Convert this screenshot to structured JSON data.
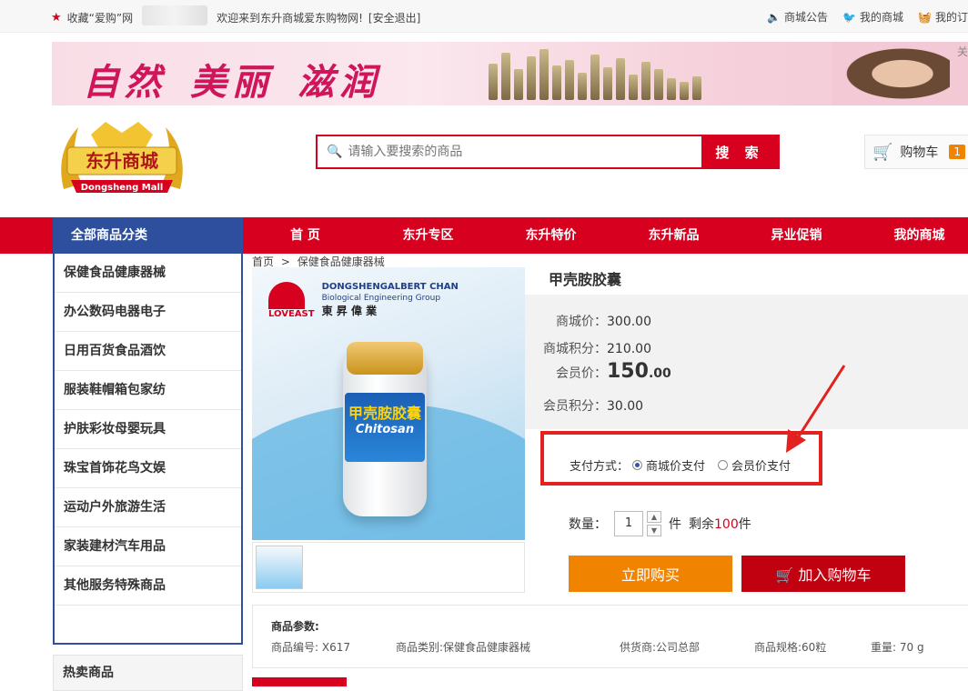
{
  "topbar": {
    "favorite": "收藏“爱购”网",
    "welcome": "欢迎来到东升商城爱东购物网!",
    "logout": "[安全退出]",
    "announce": "商城公告",
    "my_mall": "我的商城",
    "my_orders": "我的订"
  },
  "banner": {
    "slogan_1": "自然",
    "slogan_2": "美丽",
    "slogan_3": "滋润",
    "corner": "关"
  },
  "logo": {
    "cn": "东升商城",
    "en": "Dongsheng Mall"
  },
  "search": {
    "placeholder": "请输入要搜索的商品",
    "button": "搜 索"
  },
  "cart": {
    "label": "购物车",
    "count": "1"
  },
  "nav": {
    "all_categories": "全部商品分类",
    "links": [
      "首 页",
      "东升专区",
      "东升特价",
      "东升新品",
      "异业促销",
      "我的商城"
    ]
  },
  "categories": [
    "保健食品健康器械",
    "办公数码电器电子",
    "日用百货食品酒饮",
    "服装鞋帽箱包家纺",
    "护肤彩妆母婴玩具",
    "珠宝首饰花鸟文娱",
    "运动户外旅游生活",
    "家装建材汽车用品",
    "其他服务特殊商品"
  ],
  "hot_title": "热卖商品",
  "breadcrumb": {
    "home": "首页",
    "sep": ">",
    "current": "保健食品健康器械"
  },
  "product_image": {
    "brand_en": "DONGSHENGALBERT CHAN",
    "brand_en2": "Biological Engineering Group",
    "brand_logo": "LOVEAST",
    "brand_cn": "東 昇 偉 業",
    "label_cn": "甲壳胺胶囊",
    "label_en": "Chitosan"
  },
  "product": {
    "title": "甲壳胺胶囊",
    "mall_price_label": "商城价：",
    "mall_price": "300.00",
    "mall_points_label": "商城积分：",
    "mall_points": "210.00",
    "member_price_label": "会员价：",
    "member_price_int": "150",
    "member_price_dec": ".00",
    "member_points_label": "会员积分：",
    "member_points": "30.00"
  },
  "payment": {
    "label": "支付方式：",
    "option_1": "商城价支付",
    "option_2": "会员价支付",
    "selected": "商城价支付"
  },
  "quantity": {
    "label": "数量：",
    "value": "1",
    "unit": "件",
    "stock_prefix": "剩余",
    "stock": "100",
    "stock_unit": "件"
  },
  "buttons": {
    "buy_now": "立即购买",
    "add_cart": "加入购物车"
  },
  "params": {
    "heading": "商品参数:",
    "code": "商品编号: X617",
    "category": "商品类别:保健食品健康器械",
    "supplier": "供货商:公司总部",
    "spec": "商品规格:60粒",
    "weight": "重量: 70 g"
  },
  "colors": {
    "brand_red": "#d7001e",
    "nav_blue": "#2d4f9e",
    "buy_orange": "#f08300"
  }
}
